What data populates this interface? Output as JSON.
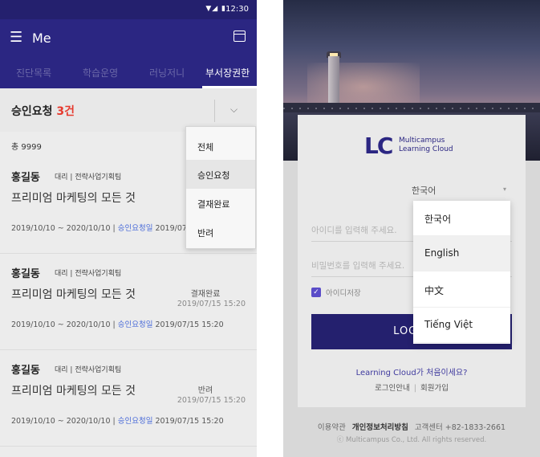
{
  "left": {
    "status_bar": {
      "icons": "▼◢ ▮",
      "time": "12:30"
    },
    "app_bar": {
      "menu_glyph": "☰",
      "title": "Me"
    },
    "tabs": [
      {
        "label": "진단목록",
        "active": false
      },
      {
        "label": "학습운영",
        "active": false
      },
      {
        "label": "러닝저니",
        "active": false
      },
      {
        "label": "부서장권한",
        "active": true
      }
    ],
    "filter": {
      "title_prefix": "승인요청 ",
      "count": "3건",
      "chevron": "⌵"
    },
    "total": "총 9999",
    "cards": [
      {
        "name": "홍길동",
        "meta": "대리 | 전략사업기획팀",
        "course": "프리미엄 마케팅의 모든 것",
        "period": "2019/10/10 ~ 2020/10/10  |  ",
        "req_label": "승인요청일",
        "req_date": " 2019/07/15 15:20",
        "status": "",
        "status_date": ""
      },
      {
        "name": "홍길동",
        "meta": "대리 | 전략사업기획팀",
        "course": "프리미엄 마케팅의 모든 것",
        "period": "2019/10/10 ~ 2020/10/10  |  ",
        "req_label": "승인요청일",
        "req_date": " 2019/07/15 15:20",
        "status": "결재완료",
        "status_date": "2019/07/15 15:20"
      },
      {
        "name": "홍길동",
        "meta": "대리 | 전략사업기획팀",
        "course": "프리미엄 마케팅의 모든 것",
        "period": "2019/10/10 ~ 2020/10/10  |  ",
        "req_label": "승인요청일",
        "req_date": " 2019/07/15 15:20",
        "status": "반려",
        "status_date": "2019/07/15 15:20"
      }
    ],
    "dropdown": {
      "items": [
        "전체",
        "승인요청",
        "결재완료",
        "반려"
      ],
      "selected": "승인요청"
    }
  },
  "right": {
    "logo": {
      "mark": "LC",
      "line1": "Multicampus",
      "line2": "Learning Cloud"
    },
    "language_select": {
      "value": "한국어",
      "caret": "▾"
    },
    "id_placeholder": "아이디를 입력해 주세요.",
    "pw_placeholder": "비밀번호를 입력해 주세요.",
    "remember": {
      "check": "✓",
      "label": "아이디저장"
    },
    "login_button": "LOGIN",
    "first_visit": "Learning Cloud가 처음이세요?",
    "links": {
      "guide": "로그인안내",
      "signup": "회원가입"
    },
    "footer": {
      "terms": "이용약관",
      "privacy": "개인정보처리방침",
      "support": "고객센터 +82-1833-2661"
    },
    "copyright": "ⓒ Multicampus Co., Ltd. All rights reserved.",
    "language_dropdown": {
      "items": [
        "한국어",
        "English",
        "中文",
        "Tiếng Việt"
      ],
      "selected": "English"
    },
    "colors": {
      "brand": "#2b2682",
      "accent": "#5a4cc8"
    }
  }
}
